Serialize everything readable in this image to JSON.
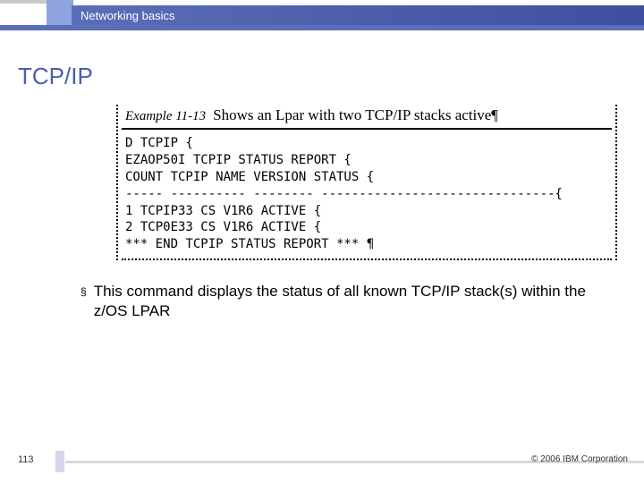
{
  "header": {
    "title": "Networking basics"
  },
  "slide": {
    "title": "TCP/IP"
  },
  "example": {
    "label": "Example 11-13",
    "caption": "Shows an Lpar with two TCP/IP stacks active¶"
  },
  "terminal": {
    "lines": [
      "D TCPIP {",
      "EZAOP50I TCPIP STATUS REPORT {",
      "COUNT TCPIP NAME VERSION STATUS {",
      "----- ---------- -------- -------------------------------{",
      "1 TCPIP33 CS V1R6 ACTIVE {",
      "2 TCP0E33 CS V1R6 ACTIVE {",
      "*** END TCPIP STATUS REPORT *** ¶"
    ]
  },
  "bullet": {
    "text": "This command displays the status of all known TCP/IP stack(s) within the z/OS LPAR"
  },
  "footer": {
    "page": "113",
    "copyright": "© 2006 IBM Corporation"
  }
}
